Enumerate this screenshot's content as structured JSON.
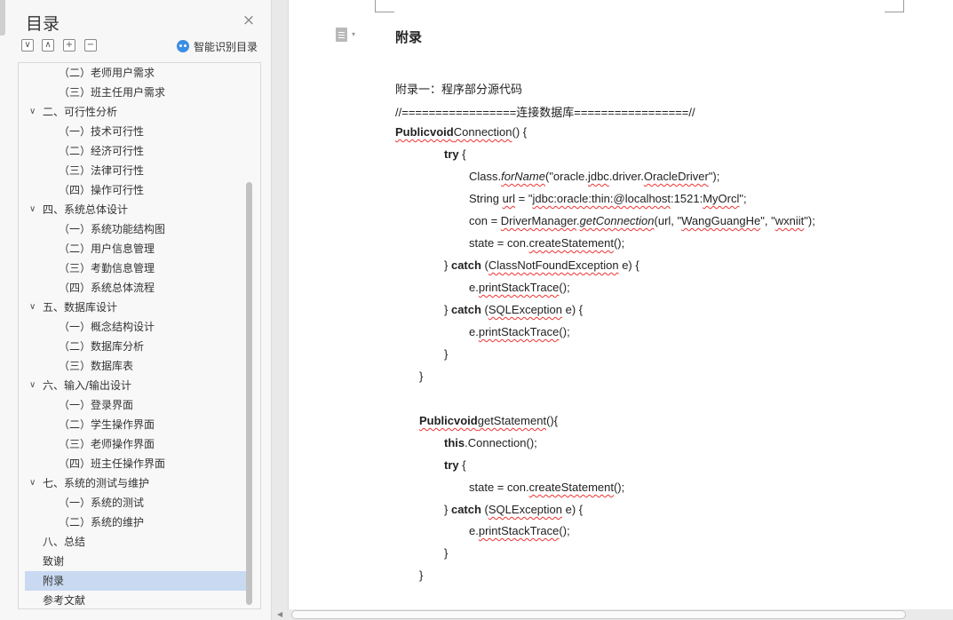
{
  "toc": {
    "title": "目录",
    "close_symbol": "×",
    "tools": {
      "collapse_all": "∨",
      "expand_all": "∧",
      "add_item": "+",
      "remove_item": "−"
    },
    "smart_toc_label": "智能识别目录",
    "items": [
      {
        "label": "（二）老师用户需求",
        "level": 2
      },
      {
        "label": "（三）班主任用户需求",
        "level": 2
      },
      {
        "label": "二、可行性分析",
        "level": 1,
        "expandable": true
      },
      {
        "label": "（一）技术可行性",
        "level": 2
      },
      {
        "label": "（二）经济可行性",
        "level": 2
      },
      {
        "label": "（三）法律可行性",
        "level": 2
      },
      {
        "label": "（四）操作可行性",
        "level": 2
      },
      {
        "label": "四、系统总体设计",
        "level": 1,
        "expandable": true
      },
      {
        "label": "（一）系统功能结构图",
        "level": 2
      },
      {
        "label": "（二）用户信息管理",
        "level": 2
      },
      {
        "label": "（三）考勤信息管理",
        "level": 2
      },
      {
        "label": "（四）系统总体流程",
        "level": 2
      },
      {
        "label": "五、数据库设计",
        "level": 1,
        "expandable": true
      },
      {
        "label": "（一）概念结构设计",
        "level": 2
      },
      {
        "label": "（二）数据库分析",
        "level": 2
      },
      {
        "label": "（三）数据库表",
        "level": 2
      },
      {
        "label": "六、输入/输出设计",
        "level": 1,
        "expandable": true
      },
      {
        "label": "（一）登录界面",
        "level": 2
      },
      {
        "label": "（二）学生操作界面",
        "level": 2
      },
      {
        "label": "（三）老师操作界面",
        "level": 2
      },
      {
        "label": "（四）班主任操作界面",
        "level": 2
      },
      {
        "label": "七、系统的测试与维护",
        "level": 1,
        "expandable": true
      },
      {
        "label": "（一）系统的测试",
        "level": 2
      },
      {
        "label": "（二）系统的维护",
        "level": 2
      },
      {
        "label": "八、总结",
        "level": 1
      },
      {
        "label": "致谢",
        "level": 0
      },
      {
        "label": "附录",
        "level": 0,
        "selected": true
      },
      {
        "label": "参考文献",
        "level": 0
      }
    ]
  },
  "document": {
    "heading": "附录",
    "subheading": "附录一：程序部分源代码",
    "lines": [
      [
        {
          "t": "//=================连接数据库=================//"
        }
      ],
      [
        {
          "t": "Publicvoid",
          "kw": true,
          "sq": true
        },
        {
          "t": "Connection",
          "sq": true
        },
        {
          "t": "() {"
        }
      ],
      [
        {
          "t": "try",
          "kw": true
        },
        {
          "t": " {"
        }
      ],
      [
        {
          "t": "Class."
        },
        {
          "t": "forName",
          "it": true,
          "sq": true
        },
        {
          "t": "(\"oracle."
        },
        {
          "t": "jdbc",
          "sq": true
        },
        {
          "t": ".driver."
        },
        {
          "t": "OracleDriver",
          "sq": true
        },
        {
          "t": "\");"
        }
      ],
      [
        {
          "t": "String "
        },
        {
          "t": "url",
          "sq": true
        },
        {
          "t": " = \""
        },
        {
          "t": "jdbc:oracle:thin:@localhost",
          "sq": true
        },
        {
          "t": ":1521:"
        },
        {
          "t": "MyOrcl",
          "sq": true
        },
        {
          "t": "\";"
        }
      ],
      [
        {
          "t": "con = "
        },
        {
          "t": "DriverManager",
          "sq": true
        },
        {
          "t": "."
        },
        {
          "t": "getConnection",
          "it": true,
          "sq": true
        },
        {
          "t": "(url, \""
        },
        {
          "t": "WangGuangHe",
          "sq": true
        },
        {
          "t": "\", \""
        },
        {
          "t": "wxniit",
          "sq": true
        },
        {
          "t": "\");"
        }
      ],
      [
        {
          "t": "state = con."
        },
        {
          "t": "createStatement",
          "sq": true
        },
        {
          "t": "();"
        }
      ],
      [
        {
          "t": "} "
        },
        {
          "t": "catch",
          "kw": true
        },
        {
          "t": " ("
        },
        {
          "t": "ClassNotFoundException",
          "sq": true
        },
        {
          "t": " e) {"
        }
      ],
      [
        {
          "t": "e."
        },
        {
          "t": "printStackTrace",
          "sq": true
        },
        {
          "t": "();"
        }
      ],
      [
        {
          "t": "} "
        },
        {
          "t": "catch",
          "kw": true
        },
        {
          "t": " ("
        },
        {
          "t": "SQLException",
          "sq": true
        },
        {
          "t": " e) {"
        }
      ],
      [
        {
          "t": "e."
        },
        {
          "t": "printStackTrace",
          "sq": true
        },
        {
          "t": "();"
        }
      ],
      [
        {
          "t": "}"
        }
      ],
      [
        {
          "t": "}"
        }
      ],
      [
        {
          "t": "Publicvoid",
          "kw": true,
          "sq": true
        },
        {
          "t": "getStatement",
          "sq": true
        },
        {
          "t": "(){"
        }
      ],
      [
        {
          "t": "this",
          "kw": true
        },
        {
          "t": ".Connection();"
        }
      ],
      [
        {
          "t": "try",
          "kw": true
        },
        {
          "t": " {"
        }
      ],
      [
        {
          "t": "state = con."
        },
        {
          "t": "createStatement",
          "sq": true
        },
        {
          "t": "();"
        }
      ],
      [
        {
          "t": "} "
        },
        {
          "t": "catch",
          "kw": true
        },
        {
          "t": " ("
        },
        {
          "t": "SQLException",
          "sq": true
        },
        {
          "t": " e) {"
        }
      ],
      [
        {
          "t": "e."
        },
        {
          "t": "printStackTrace",
          "sq": true
        },
        {
          "t": "();"
        }
      ],
      [
        {
          "t": "}"
        }
      ],
      [
        {
          "t": "}"
        }
      ]
    ]
  }
}
